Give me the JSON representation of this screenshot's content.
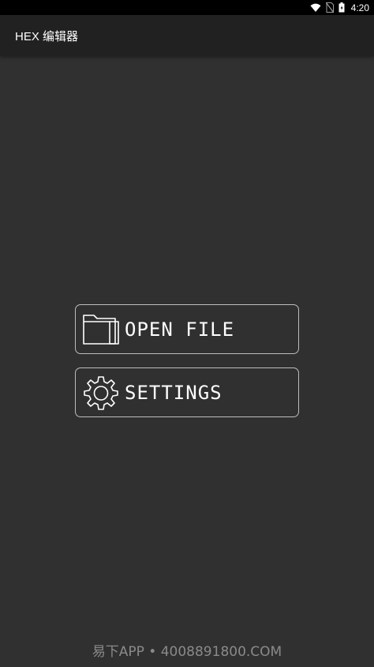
{
  "status_bar": {
    "time": "4:20",
    "icons": [
      "wifi-icon",
      "no-sim-icon",
      "battery-icon"
    ]
  },
  "app_bar": {
    "title": "HEX 编辑器"
  },
  "menu": {
    "open_file_label": "OPEN FILE",
    "open_file_icon": "folder-icon",
    "settings_label": "SETTINGS",
    "settings_icon": "gear-icon"
  },
  "watermark": {
    "text": "易下APP • 4008891800.COM"
  },
  "colors": {
    "background": "#303030",
    "app_bar": "#212121",
    "status_bar": "#000000",
    "button_border": "#bdbdbd",
    "text": "#ffffff",
    "watermark": "#8a8a8a"
  }
}
